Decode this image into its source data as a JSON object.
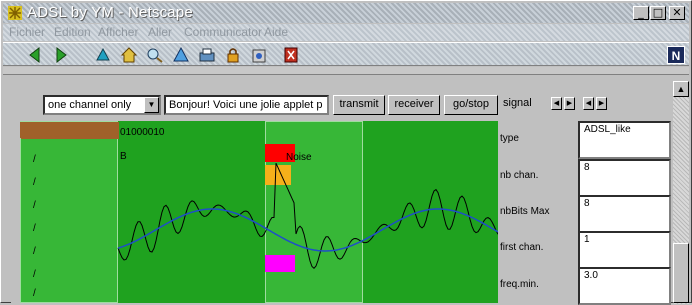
{
  "window": {
    "title": "ADSL by YM - Netscape",
    "minimize": "_",
    "maximize": "□",
    "close": "✕"
  },
  "menu": [
    "Fichier",
    "Edition",
    "Afficher",
    "Aller",
    "Communicator",
    "Aide"
  ],
  "toolbar": {
    "icons": [
      "back-icon",
      "forward-icon",
      "reload-icon",
      "home-icon",
      "search-icon",
      "netscape-guide-icon",
      "print-icon",
      "security-icon",
      "shop-icon",
      "stop-icon"
    ],
    "logo": "N"
  },
  "controls": {
    "channel_mode": "one channel only",
    "message": "Bonjour! Voici une jolie applet p",
    "transmit": "transmit",
    "receiver": "receiver",
    "go_stop": "go/stop",
    "signal_label": "signal"
  },
  "applet": {
    "channel_header": "0100/0010",
    "slashes": [
      "/",
      "/",
      "/",
      "/",
      "/",
      "/",
      "/",
      "/"
    ],
    "bits": "01000010",
    "b_label": "B",
    "noise_label": "Noise",
    "colors": {
      "background": "#1fa21f",
      "panel": "#37b737",
      "header": "#a0612a",
      "red_block": "#ff0000",
      "orange_block": "#f5b01a",
      "magenta_block": "#ff00ff",
      "black_signal": "#000000",
      "blue_signal": "#1e4fc8"
    }
  },
  "params": [
    {
      "label": "type",
      "value": "ADSL_like"
    },
    {
      "label": "nb chan.",
      "value": "8"
    },
    {
      "label": "nbBits Max",
      "value": "8"
    },
    {
      "label": "first chan.",
      "value": "1"
    },
    {
      "label": "freq.min.",
      "value": "3.0"
    }
  ]
}
